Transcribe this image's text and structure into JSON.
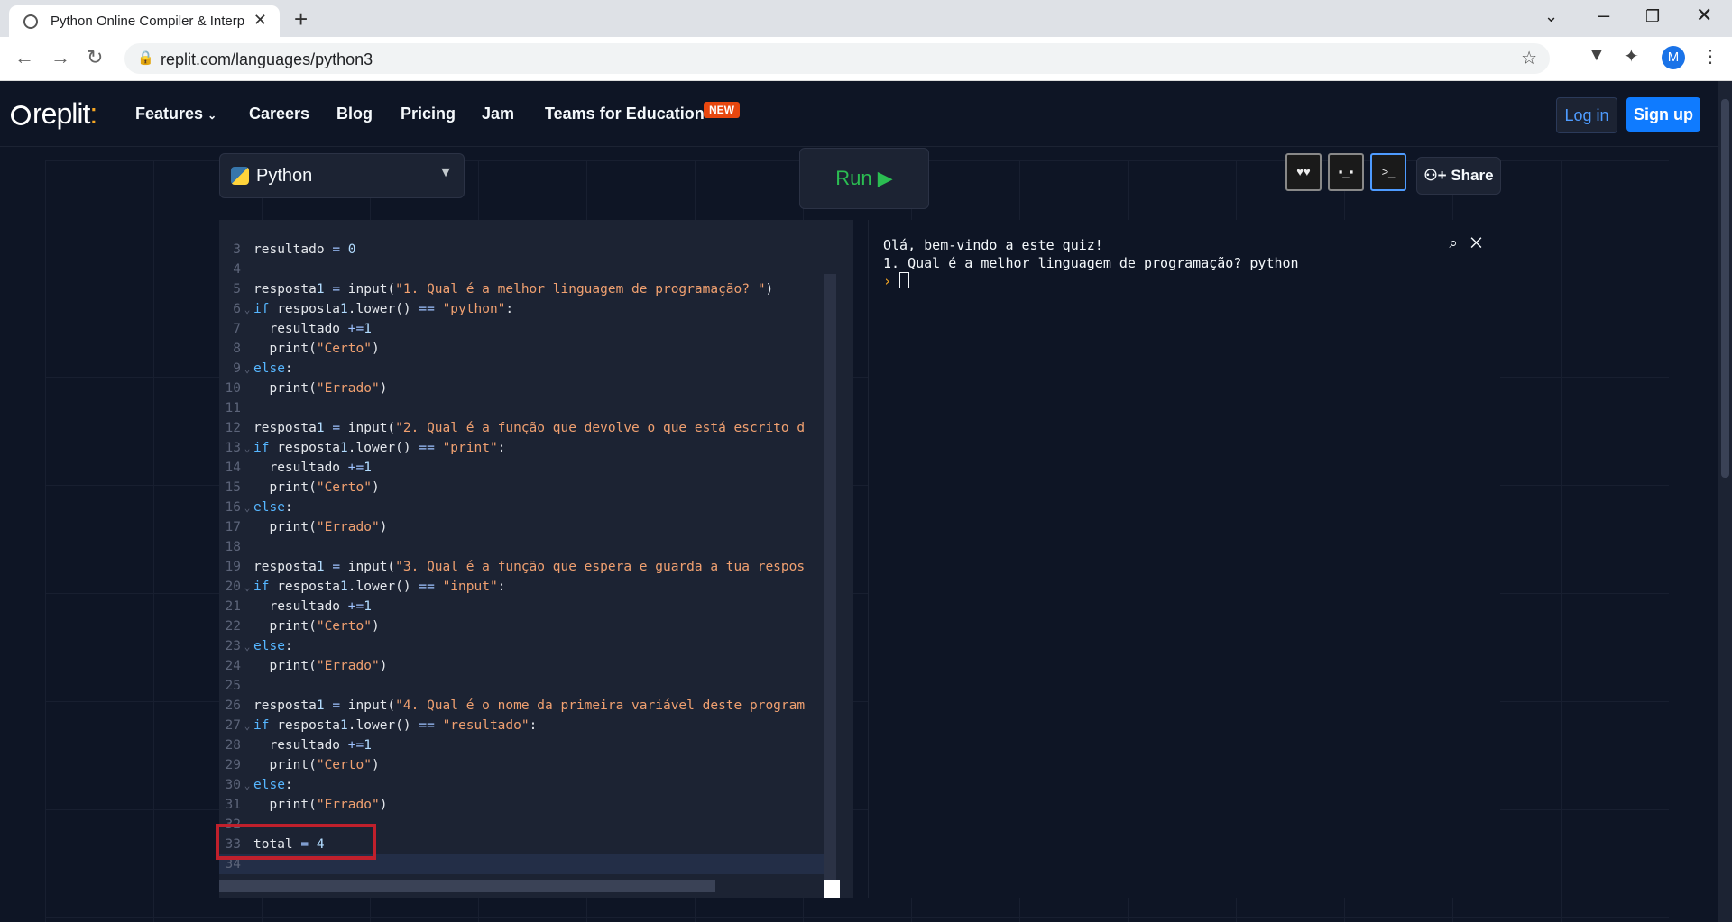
{
  "browser": {
    "tab_title": "Python Online Compiler & Interp",
    "url": "replit.com/languages/python3",
    "profile_initial": "M"
  },
  "site": {
    "logo": "replit",
    "nav": {
      "features": "Features",
      "careers": "Careers",
      "blog": "Blog",
      "pricing": "Pricing",
      "jam": "Jam",
      "teams": "Teams for Education",
      "badge": "NEW"
    },
    "login": "Log in",
    "signup": "Sign up"
  },
  "workspace": {
    "language": "Python",
    "run": "Run ▶",
    "share": "Share"
  },
  "editor": {
    "lines": [
      {
        "n": "3",
        "t": "resultado = 0"
      },
      {
        "n": "4",
        "t": ""
      },
      {
        "n": "5",
        "t": "resposta1 = input(\"1. Qual é a melhor linguagem de programação? \")"
      },
      {
        "n": "6",
        "t": "if resposta1.lower() == \"python\":",
        "fold": true
      },
      {
        "n": "7",
        "t": "  resultado +=1"
      },
      {
        "n": "8",
        "t": "  print(\"Certo\")"
      },
      {
        "n": "9",
        "t": "else:",
        "fold": true
      },
      {
        "n": "10",
        "t": "  print(\"Errado\")"
      },
      {
        "n": "11",
        "t": ""
      },
      {
        "n": "12",
        "t": "resposta1 = input(\"2. Qual é a função que devolve o que está escrito d"
      },
      {
        "n": "13",
        "t": "if resposta1.lower() == \"print\":",
        "fold": true
      },
      {
        "n": "14",
        "t": "  resultado +=1"
      },
      {
        "n": "15",
        "t": "  print(\"Certo\")"
      },
      {
        "n": "16",
        "t": "else:",
        "fold": true
      },
      {
        "n": "17",
        "t": "  print(\"Errado\")"
      },
      {
        "n": "18",
        "t": ""
      },
      {
        "n": "19",
        "t": "resposta1 = input(\"3. Qual é a função que espera e guarda a tua respos"
      },
      {
        "n": "20",
        "t": "if resposta1.lower() == \"input\":",
        "fold": true
      },
      {
        "n": "21",
        "t": "  resultado +=1"
      },
      {
        "n": "22",
        "t": "  print(\"Certo\")"
      },
      {
        "n": "23",
        "t": "else:",
        "fold": true
      },
      {
        "n": "24",
        "t": "  print(\"Errado\")"
      },
      {
        "n": "25",
        "t": ""
      },
      {
        "n": "26",
        "t": "resposta1 = input(\"4. Qual é o nome da primeira variável deste program"
      },
      {
        "n": "27",
        "t": "if resposta1.lower() == \"resultado\":",
        "fold": true
      },
      {
        "n": "28",
        "t": "  resultado +=1"
      },
      {
        "n": "29",
        "t": "  print(\"Certo\")"
      },
      {
        "n": "30",
        "t": "else:",
        "fold": true
      },
      {
        "n": "31",
        "t": "  print(\"Errado\")"
      },
      {
        "n": "32",
        "t": ""
      },
      {
        "n": "33",
        "t": "total = 4"
      },
      {
        "n": "34",
        "t": "",
        "current": true
      }
    ]
  },
  "console": {
    "line1": "Olá, bem-vindo a este quiz!",
    "line2": "1. Qual é a melhor linguagem de programação? python",
    "prompt": "›"
  }
}
